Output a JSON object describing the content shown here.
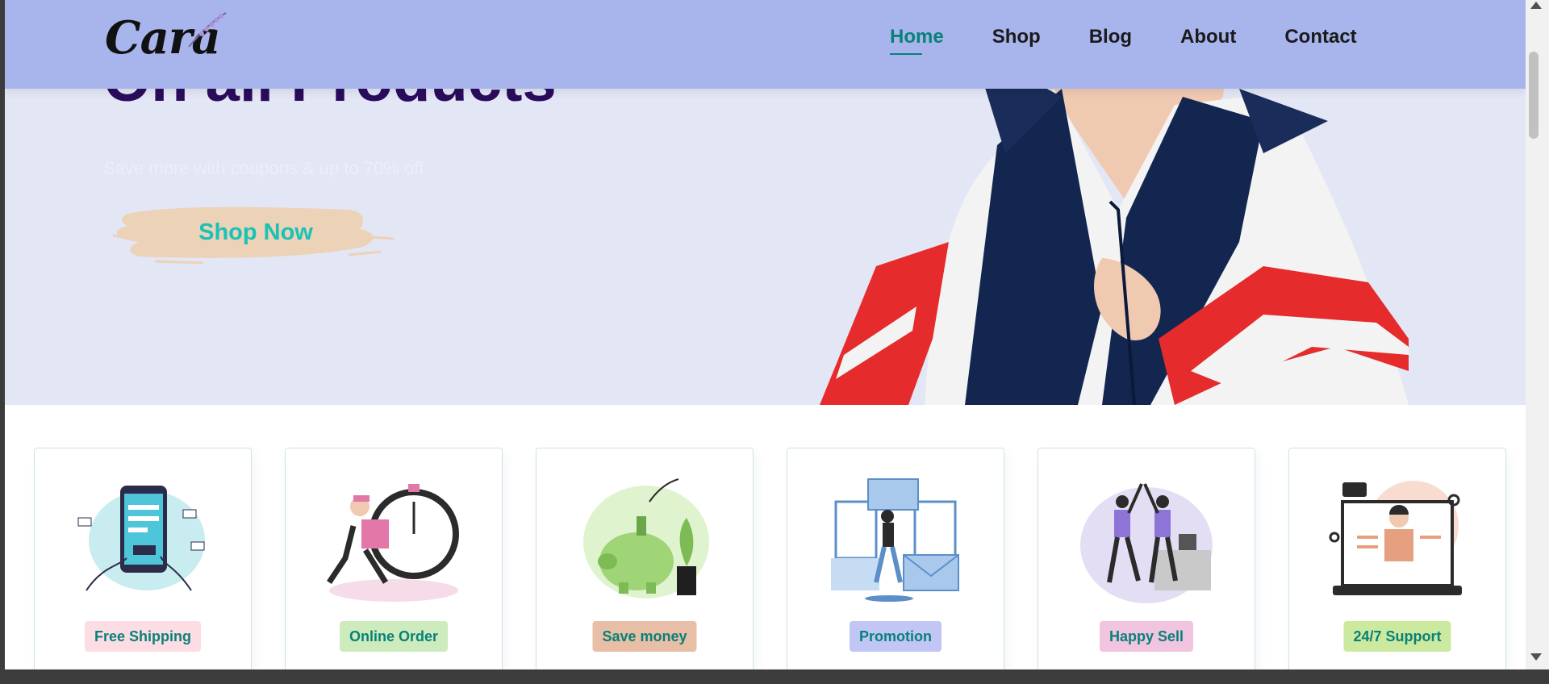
{
  "header": {
    "logo_text": "Cara",
    "nav": [
      {
        "label": "Home",
        "active": true
      },
      {
        "label": "Shop",
        "active": false
      },
      {
        "label": "Blog",
        "active": false
      },
      {
        "label": "About",
        "active": false
      },
      {
        "label": "Contact",
        "active": false
      }
    ]
  },
  "hero": {
    "title": "On all Products",
    "subtitle": "Save more with coupons & up to 70% off",
    "button_label": "Shop Now"
  },
  "features": [
    {
      "label": "Free Shipping",
      "badge_color": "#fddde4"
    },
    {
      "label": "Online Order",
      "badge_color": "#cdebbc"
    },
    {
      "label": "Save money",
      "badge_color": "#e8bfa6"
    },
    {
      "label": "Promotion",
      "badge_color": "#c2c6f5"
    },
    {
      "label": "Happy Sell",
      "badge_color": "#f1c4e0"
    },
    {
      "label": "24/7 Support",
      "badge_color": "#cce9a0"
    }
  ],
  "colors": {
    "header_bg": "#a8b5ed",
    "hero_bg": "#e3e6f4",
    "accent": "#088178",
    "title": "#2a0c5c"
  }
}
